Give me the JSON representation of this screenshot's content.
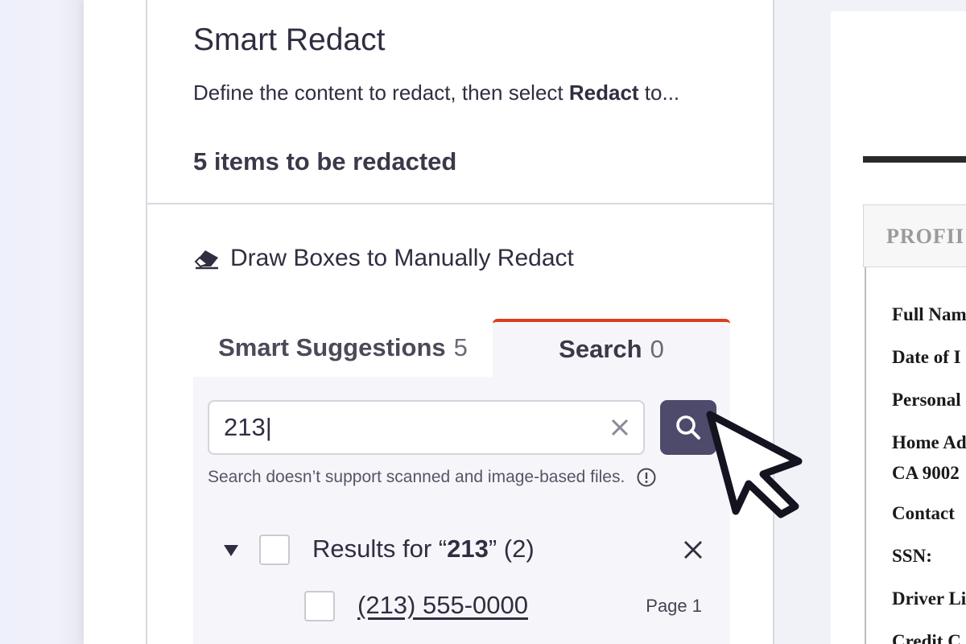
{
  "panel": {
    "title": "Smart Redact",
    "description_prefix": "Define the content to redact, then select ",
    "description_bold": "Redact",
    "description_suffix": " to...",
    "items_count_text": "5 items to be redacted",
    "draw_boxes_label": "Draw Boxes to Manually Redact"
  },
  "tabs": [
    {
      "label": "Smart Suggestions",
      "count": "5"
    },
    {
      "label": "Search",
      "count": "0",
      "active": true
    }
  ],
  "search": {
    "value": "213|",
    "hint": "Search doesn’t support scanned and image-based files."
  },
  "results": {
    "label_prefix": "Results for “",
    "query": "213",
    "label_suffix": "” (2)",
    "items": [
      {
        "text": "(213) 555-0000",
        "page": "Page 1"
      }
    ]
  },
  "document": {
    "header": "PROFII",
    "lines": [
      "Full Nam",
      "Date of I",
      "Personal",
      "Home Ad",
      "CA 9002",
      "Contact",
      "SSN:",
      "Driver Li",
      "Credit C"
    ]
  },
  "icons": {
    "copy": "copy-icon",
    "eraser": "eraser-icon",
    "search": "search-icon",
    "clear": "close-icon",
    "info": "info-icon",
    "caret": "caret-down-icon",
    "cursor": "mouse-pointer-icon"
  },
  "colors": {
    "accent": "#d9401a",
    "button": "#4d4a6c",
    "text": "#2f2e41"
  }
}
